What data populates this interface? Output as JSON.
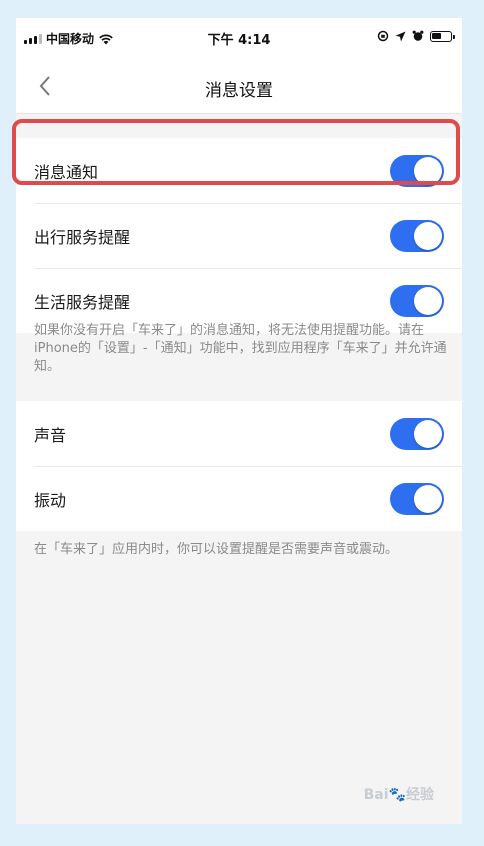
{
  "status_bar": {
    "carrier": "中国移动",
    "time": "下午 4:14"
  },
  "nav": {
    "title": "消息设置",
    "back_icon": "chevron-left-icon"
  },
  "group1": {
    "rows": [
      {
        "label": "消息通知",
        "enabled": true
      },
      {
        "label": "出行服务提醒",
        "enabled": true
      },
      {
        "label": "生活服务提醒",
        "enabled": true
      }
    ],
    "note": "如果你没有开启「车来了」的消息通知，将无法使用提醒功能。请在iPhone的「设置」-「通知」功能中，找到应用程序「车来了」并允许通知。"
  },
  "group2": {
    "rows": [
      {
        "label": "声音",
        "enabled": true
      },
      {
        "label": "振动",
        "enabled": true
      }
    ],
    "note": "在「车来了」应用内时，你可以设置提醒是否需要声音或震动。"
  },
  "colors": {
    "toggle_on": "#2d6ff0",
    "highlight": "#e04a4a",
    "background": "#dff0fb"
  }
}
